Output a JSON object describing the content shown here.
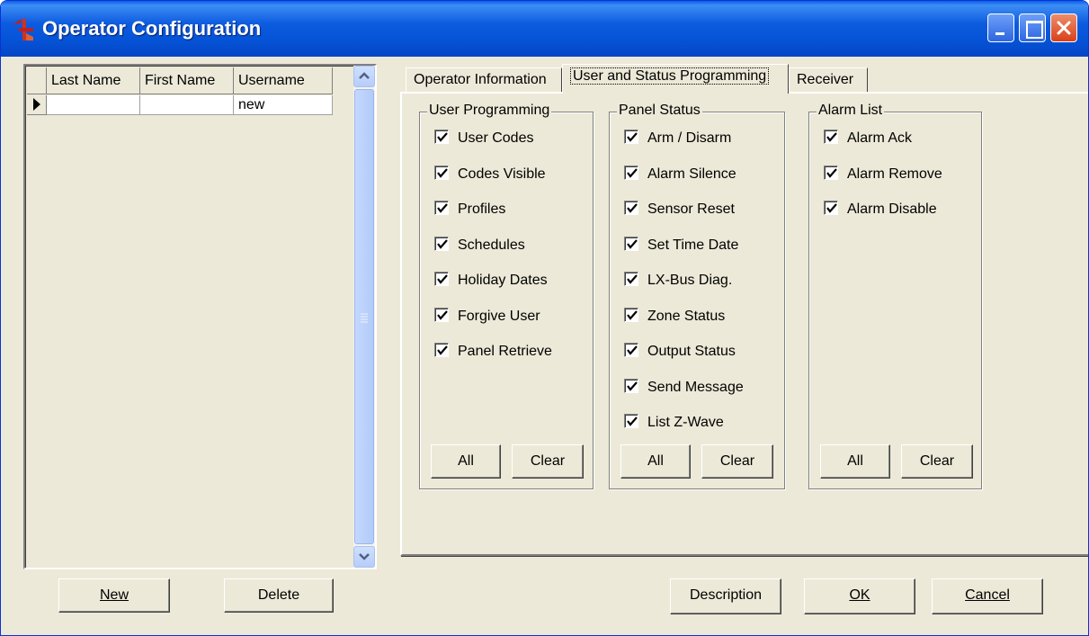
{
  "window": {
    "title": "Operator Configuration",
    "buttons": [
      "minimize",
      "maximize",
      "close"
    ]
  },
  "grid": {
    "columns": [
      "Last Name",
      "First Name",
      "Username"
    ],
    "rows": [
      [
        "",
        "",
        "new"
      ]
    ]
  },
  "left_buttons": {
    "new": "New",
    "delete": "Delete"
  },
  "tabs": [
    {
      "label": "Operator Information",
      "active": false
    },
    {
      "label": "User and Status Programming",
      "active": true
    },
    {
      "label": "Receiver",
      "active": false
    }
  ],
  "groups": {
    "user_programming": {
      "title": "User Programming",
      "items": [
        "User Codes",
        "Codes Visible",
        "Profiles",
        "Schedules",
        "Holiday Dates",
        "Forgive User",
        "Panel Retrieve"
      ],
      "checked": [
        true,
        true,
        true,
        true,
        true,
        true,
        true
      ],
      "all": "All",
      "clear": "Clear"
    },
    "panel_status": {
      "title": "Panel Status",
      "items": [
        "Arm / Disarm",
        "Alarm Silence",
        "Sensor Reset",
        "Set Time Date",
        "LX-Bus Diag.",
        "Zone Status",
        "Output Status",
        "Send Message",
        "List Z-Wave"
      ],
      "checked": [
        true,
        true,
        true,
        true,
        true,
        true,
        true,
        true,
        true
      ],
      "all": "All",
      "clear": "Clear"
    },
    "alarm_list": {
      "title": "Alarm List",
      "items": [
        "Alarm Ack",
        "Alarm Remove",
        "Alarm Disable"
      ],
      "checked": [
        true,
        true,
        true
      ],
      "all": "All",
      "clear": "Clear"
    }
  },
  "bottom_buttons": {
    "description": "Description",
    "ok": "OK",
    "cancel": "Cancel"
  },
  "colors": {
    "titlebar": "#0553d6",
    "face": "#ece9d8",
    "scrollbar": "#b7cdf8",
    "close": "#d8401a"
  }
}
